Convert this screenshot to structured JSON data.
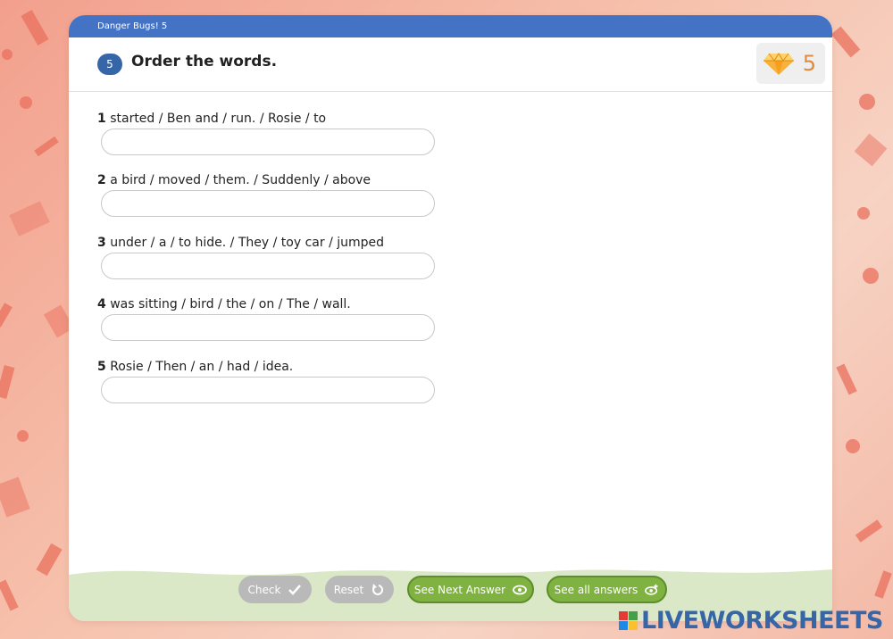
{
  "window": {
    "topbar_title": "Danger Bugs! 5"
  },
  "exercise": {
    "number": "5",
    "instruction": "Order the words.",
    "points": "5",
    "points_icon": "diamond-gem-icon"
  },
  "questions": [
    {
      "num": "1",
      "text": " started / Ben and / run. / Rosie / to",
      "value": ""
    },
    {
      "num": "2",
      "text": " a bird / moved / them. / Suddenly / above",
      "value": ""
    },
    {
      "num": "3",
      "text": " under / a / to hide. / They / toy car / jumped",
      "value": ""
    },
    {
      "num": "4",
      "text": " was sitting / bird / the / on / The / wall.",
      "value": ""
    },
    {
      "num": "5",
      "text": " Rosie / Then / an / had / idea.",
      "value": ""
    }
  ],
  "buttons": {
    "check": "Check",
    "reset": "Reset",
    "see_next": "See Next Answer",
    "see_all": "See all answers"
  },
  "branding": {
    "logo_text": "LIVEWORKSHEETS"
  },
  "colors": {
    "topbar": "#4472c4",
    "badge": "#3766a8",
    "points": "#e08a3c",
    "green_button": "#7fb241",
    "grey_button": "#b9b9b9"
  }
}
